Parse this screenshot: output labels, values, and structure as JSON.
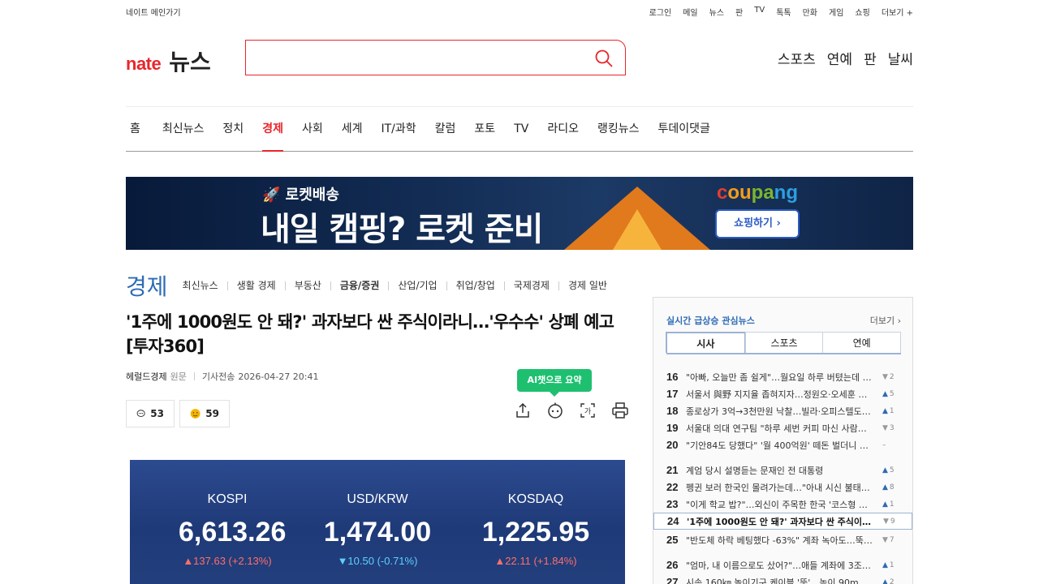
{
  "topbar": {
    "home_link": "네이트 메인가기",
    "links": [
      "로그인",
      "메일",
      "뉴스",
      "판",
      "TV",
      "톡톡",
      "만화",
      "게임",
      "쇼핑",
      "더보기 +"
    ]
  },
  "header": {
    "logo_brand": "nate",
    "logo_section": "뉴스",
    "search_value": "",
    "right_links": [
      "스포츠",
      "연예",
      "판",
      "날씨"
    ]
  },
  "gnb": {
    "items": [
      "홈",
      "최신뉴스",
      "정치",
      "경제",
      "사회",
      "세계",
      "IT/과학",
      "칼럼",
      "포토",
      "TV",
      "라디오",
      "랭킹뉴스",
      "투데이댓글"
    ],
    "active_index": 3
  },
  "banner": {
    "sub": "🚀 로켓배송",
    "main": "내일 캠핑? 로켓 준비",
    "brand": [
      "c",
      "ou",
      "pa",
      "ng"
    ],
    "button": "쇼핑하기 ›"
  },
  "section": {
    "title": "경제",
    "items": [
      "최신뉴스",
      "생활 경제",
      "부동산",
      "금융/증권",
      "산업/기업",
      "취업/창업",
      "국제경제",
      "경제 일반"
    ],
    "active_index": 3
  },
  "article": {
    "headline": "'1주에 1000원도 안 돼?' 과자보다 싼 주식이라니…'우수수' 상폐 예고 [투자360]",
    "source": "헤럴드경제",
    "original_label": "원문",
    "sent_label": "기사전송",
    "datetime": "2026-04-27 20:41",
    "comment_count": "53",
    "reaction_count": "59",
    "ai_badge": "AI챗으로 요약",
    "photo": {
      "kospi_label": "KOSPI",
      "kospi_value": "6,613.26",
      "kospi_change": "▲137.63 (+2.13%)",
      "usd_label": "USD/KRW",
      "usd_value": "1,474.00",
      "usd_change": "▼10.50 (-0.71%)",
      "kosdaq_label": "KOSDAQ",
      "kosdaq_value": "1,225.95",
      "kosdaq_change": "▲22.11 (+1.84%)"
    }
  },
  "sidebar": {
    "title": "실시간 급상승 관심뉴스",
    "more": "더보기 ›",
    "tabs": [
      "시사",
      "스포츠",
      "연예"
    ],
    "active_tab": 0,
    "ranks": [
      {
        "n": "16",
        "title": "\"아빠, 오늘만 좀 쉴게\"…월요일 하루 버텼는데 …",
        "dir": "down",
        "chg": "2"
      },
      {
        "n": "17",
        "title": "서울서 與野 지지율 좁혀지자…정원오·오세훈 …",
        "dir": "up",
        "chg": "5"
      },
      {
        "n": "18",
        "title": "종로상가 3억→3천만원 낙찰…빌라·오피스텔도 …",
        "dir": "up",
        "chg": "1"
      },
      {
        "n": "19",
        "title": "서울대 의대 연구팀 \"하루 세번 커피 마신 사람이…",
        "dir": "down",
        "chg": "3"
      },
      {
        "n": "20",
        "title": "\"기안84도 당했다\" '월 400억원' 떼돈 벌더니 순…",
        "dir": "same",
        "chg": "–"
      },
      {
        "n": "21",
        "title": "계엄 당시 설명듣는 문재인 전 대통령",
        "dir": "up",
        "chg": "5"
      },
      {
        "n": "22",
        "title": "펭귄 보러 한국인 몰려가는데…\"아내 시신 불태…",
        "dir": "up",
        "chg": "8"
      },
      {
        "n": "23",
        "title": "\"이게 학교 밥?\"…외신이 주목한 한국 '코스형 급…",
        "dir": "up",
        "chg": "1"
      },
      {
        "n": "24",
        "title": "'1주에 1000원도 안 돼?' 과자보다 싼 주식이라니…'우…",
        "dir": "down",
        "chg": "9"
      },
      {
        "n": "25",
        "title": "\"반도체 하락 베팅했다 -63%\" 계좌 녹아도…뚝…",
        "dir": "down",
        "chg": "7"
      },
      {
        "n": "26",
        "title": "\"엄마, 내 이름으로도 샀어?\"…애들 계좌에 3조…",
        "dir": "up",
        "chg": "1"
      },
      {
        "n": "27",
        "title": "시속 160㎞ 놀이기구 케이블 '뚝'…높이 90m서 …",
        "dir": "up",
        "chg": "2"
      }
    ],
    "current_rank_index": 8
  },
  "colors": {
    "brand_red": "#e8262b",
    "section_blue": "#2d6bb5",
    "ai_green": "#1ec070"
  }
}
